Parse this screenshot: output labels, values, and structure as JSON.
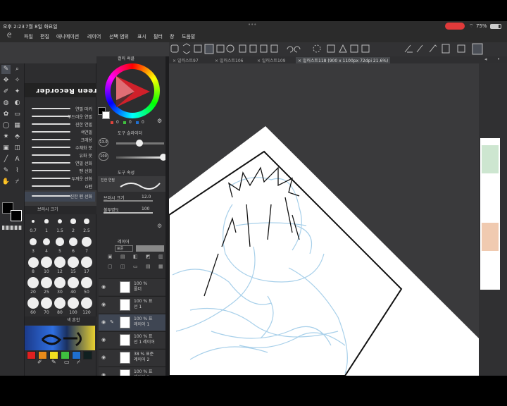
{
  "status": {
    "time": "오후 2:23",
    "date": "7월 8일 화요일",
    "dots": "•••",
    "battery": "75%"
  },
  "menu": [
    "파일",
    "편집",
    "애니메이션",
    "레이어",
    "선택 범위",
    "표시",
    "필터",
    "창",
    "도움말"
  ],
  "recorder_label": "Super Screen Recorder",
  "tabs": [
    "일러스트97",
    "일러스트106",
    "일러스트109",
    "일러스트118 (900 x 1100px 72dpi 21.6%)"
  ],
  "brushes": [
    "연필 마커",
    "부드러운 연필",
    "진한 연필",
    "색연필",
    "크래용",
    "수채화 붓",
    "유화 붓",
    "연필 선화",
    "펜 선화",
    "두꺼운 선화",
    "G펜",
    "진한 펜 선화"
  ],
  "tool_property": {
    "title": "도구 속성",
    "size_label": "브러시 크기",
    "size_value": "12.0",
    "opacity_label": "불투명도",
    "opacity_value": "100",
    "brush_preview_label": "진한 연필"
  },
  "brush_size_panel": {
    "title": "브러시 크기",
    "sizes": [
      "0.7",
      "1",
      "1.5",
      "2",
      "2.5",
      "3",
      "4",
      "5",
      "6",
      "7",
      "8",
      "10",
      "12",
      "15",
      "17",
      "20",
      "25",
      "30",
      "40",
      "50",
      "60",
      "70",
      "80",
      "100",
      "120"
    ]
  },
  "color_wheel": {
    "title": "컬러 써클",
    "values": [
      "0",
      "0",
      "0"
    ],
    "fg_color": "#000000",
    "bg_color": "#ffffff"
  },
  "layer_property": {
    "title": "도구 슬라이더",
    "size_value": "13.0",
    "opacity_value": "100"
  },
  "layers": {
    "title": "레이어",
    "blend": "표준",
    "opacity": "100",
    "items": [
      {
        "opacity": "100 %",
        "name": "폴더"
      },
      {
        "opacity": "100 % 표",
        "name": "선 1"
      },
      {
        "opacity": "100 % 표",
        "name": "레이어 1"
      },
      {
        "opacity": "100 % 표",
        "name": "선 1 레이어"
      },
      {
        "opacity": "38 % 표준",
        "name": "레이어 2"
      },
      {
        "opacity": "100 % 표",
        "name": "레이어 3"
      }
    ]
  },
  "color_set": {
    "title": "색 혼합",
    "swatches": [
      "#e02020",
      "#e88a1a",
      "#f0e020",
      "#3fbf3f",
      "#1f6fd0",
      "#102020"
    ]
  },
  "colors": {
    "sketch": "#a8d0ea",
    "ink": "#111111",
    "accent": "#e0443c"
  }
}
